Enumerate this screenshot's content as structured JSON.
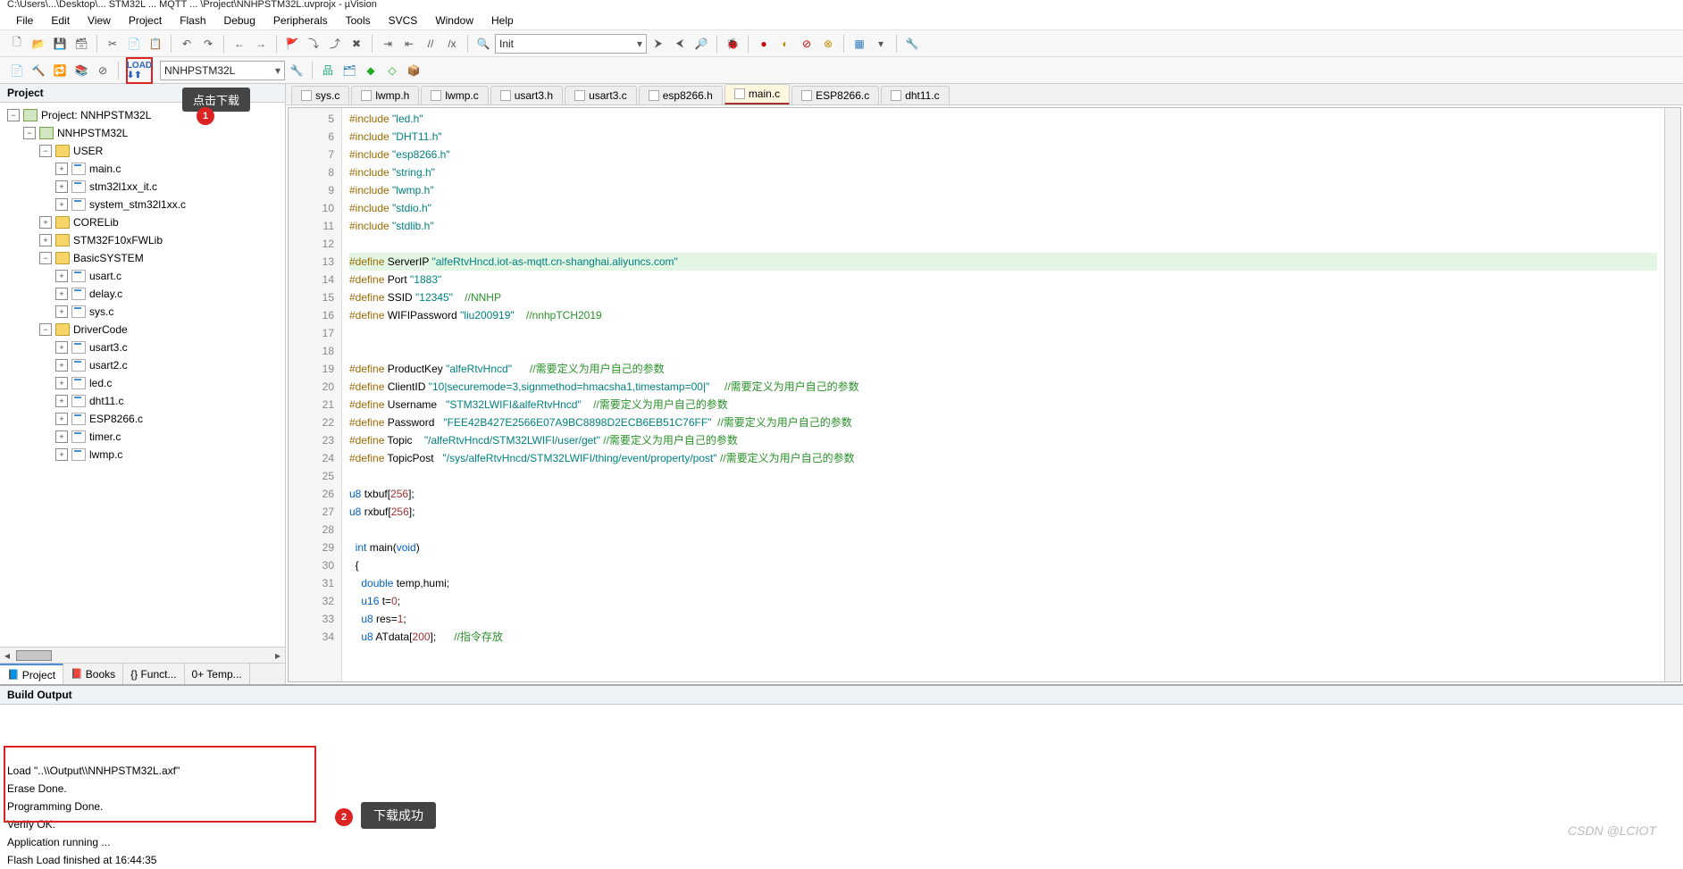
{
  "title": "C:\\Users\\...\\Desktop\\... STM32L ... MQTT ... \\Project\\NNHPSTM32L.uvprojx - µVision",
  "menu": [
    "File",
    "Edit",
    "View",
    "Project",
    "Flash",
    "Debug",
    "Peripherals",
    "Tools",
    "SVCS",
    "Window",
    "Help"
  ],
  "toolbar_combo": "Init",
  "target": "NNHPSTM32L",
  "tip1_label": "点击下载",
  "tip2_label": "下载成功",
  "badge1": "1",
  "badge2": "2",
  "project_panel_title": "Project",
  "side_tabs": {
    "project": "Project",
    "books": "Books",
    "funct": "{} Funct...",
    "temp": "0+ Temp..."
  },
  "tree": {
    "root": "Project: NNHPSTM32L",
    "target": "NNHPSTM32L",
    "groups": [
      {
        "name": "USER",
        "files": [
          "main.c",
          "stm32l1xx_it.c",
          "system_stm32l1xx.c"
        ]
      },
      {
        "name": "CORELib",
        "files": []
      },
      {
        "name": "STM32F10xFWLib",
        "files": []
      },
      {
        "name": "BasicSYSTEM",
        "files": [
          "usart.c",
          "delay.c",
          "sys.c"
        ]
      },
      {
        "name": "DriverCode",
        "files": [
          "usart3.c",
          "usart2.c",
          "led.c",
          "dht11.c",
          "ESP8266.c",
          "timer.c",
          "lwmp.c"
        ]
      }
    ]
  },
  "tabs": [
    "sys.c",
    "lwmp.h",
    "lwmp.c",
    "usart3.h",
    "usart3.c",
    "esp8266.h",
    "main.c",
    "ESP8266.c",
    "dht11.c"
  ],
  "active_tab": "main.c",
  "first_line": 5,
  "code_lines": [
    {
      "t": "#include \"led.h\"",
      "k": "inc"
    },
    {
      "t": "#include \"DHT11.h\"",
      "k": "inc"
    },
    {
      "t": "#include \"esp8266.h\"",
      "k": "inc"
    },
    {
      "t": "#include \"string.h\"",
      "k": "inc"
    },
    {
      "t": "#include \"lwmp.h\"",
      "k": "inc"
    },
    {
      "t": "#include \"stdio.h\"",
      "k": "inc"
    },
    {
      "t": "#include \"stdlib.h\"",
      "k": "inc"
    },
    {
      "t": "",
      "k": ""
    },
    {
      "t": "#define ServerIP \"alfeRtvHncd.iot-as-mqtt.cn-shanghai.aliyuncs.com\"",
      "k": "def",
      "hl": true
    },
    {
      "t": "#define Port \"1883\"",
      "k": "def"
    },
    {
      "t": "#define SSID \"12345\"    //NNHP",
      "k": "defc"
    },
    {
      "t": "#define WIFIPassword \"liu200919\"    //nnhpTCH2019",
      "k": "defc"
    },
    {
      "t": "",
      "k": ""
    },
    {
      "t": "",
      "k": ""
    },
    {
      "t": "#define ProductKey \"alfeRtvHncd\"      //需要定义为用户自己的参数",
      "k": "defc"
    },
    {
      "t": "#define ClientID \"10|securemode=3,signmethod=hmacsha1,timestamp=00|\"     //需要定义为用户自己的参数",
      "k": "defc"
    },
    {
      "t": "#define Username   \"STM32LWIFI&alfeRtvHncd\"    //需要定义为用户自己的参数",
      "k": "defc"
    },
    {
      "t": "#define Password   \"FEE42B427E2566E07A9BC8898D2ECB6EB51C76FF\"  //需要定义为用户自己的参数",
      "k": "defc"
    },
    {
      "t": "#define Topic    \"/alfeRtvHncd/STM32LWIFI/user/get\" //需要定义为用户自己的参数",
      "k": "defc"
    },
    {
      "t": "#define TopicPost   \"/sys/alfeRtvHncd/STM32LWIFI/thing/event/property/post\" //需要定义为用户自己的参数",
      "k": "defc"
    },
    {
      "t": "",
      "k": ""
    },
    {
      "t": "u8 txbuf[256];",
      "k": "decl"
    },
    {
      "t": "u8 rxbuf[256];",
      "k": "decl"
    },
    {
      "t": "",
      "k": ""
    },
    {
      "t": "  int main(void)",
      "k": "fn"
    },
    {
      "t": "  {",
      "k": "plain",
      "fold": true
    },
    {
      "t": "    double temp,humi;",
      "k": "decl2"
    },
    {
      "t": "    u16 t=0;",
      "k": "decl2"
    },
    {
      "t": "    u8 res=1;",
      "k": "decl2"
    },
    {
      "t": "    u8 ATdata[200];      //指令存放",
      "k": "declc"
    }
  ],
  "build_title": "Build Output",
  "build_lines": [
    "Load \"..\\\\Output\\\\NNHPSTM32L.axf\"",
    "Erase Done.",
    "Programming Done.",
    "Verify OK.",
    "Application running ...",
    "Flash Load finished at 16:44:35"
  ],
  "watermark": "CSDN @LCIOT"
}
